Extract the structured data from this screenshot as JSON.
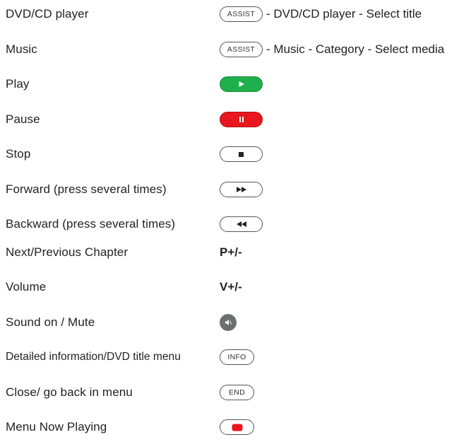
{
  "rows": [
    {
      "label": "DVD/CD player",
      "button": "ASSIST",
      "text": "- DVD/CD player - Select title"
    },
    {
      "label": "Music",
      "button": "ASSIST",
      "text": "- Music - Category - Select media"
    },
    {
      "label": "Play"
    },
    {
      "label": "Pause"
    },
    {
      "label": "Stop"
    },
    {
      "label": "Forward (press several times)"
    },
    {
      "label": "Backward (press several times)"
    },
    {
      "label": "Next/Previous Chapter",
      "text": "P+/-"
    },
    {
      "label": "Volume",
      "text": "V+/-"
    },
    {
      "label": "Sound on / Mute"
    },
    {
      "label": "Detailed information/DVD title menu",
      "button": "INFO"
    },
    {
      "label": "Close/ go back in menu",
      "button": "END"
    },
    {
      "label": "Menu Now Playing"
    }
  ],
  "icons": {
    "play": "play-icon",
    "pause": "pause-icon",
    "stop": "stop-icon",
    "forward": "fast-forward-icon",
    "backward": "rewind-icon",
    "mute": "mute-icon",
    "now_playing": "red-square-icon"
  },
  "colors": {
    "green_button": "#1fb04b",
    "red_button": "#e8161e",
    "grey_circle": "#6d6e70"
  }
}
